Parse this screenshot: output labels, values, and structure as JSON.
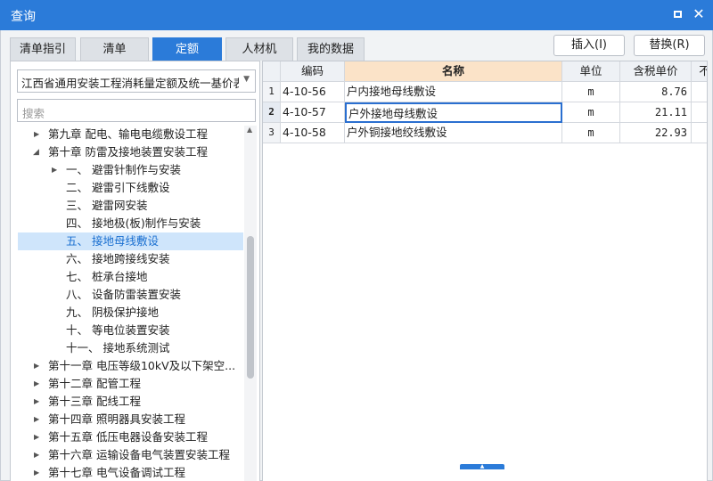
{
  "window": {
    "title": "查询",
    "maximize_icon": "maximize-icon",
    "close_glyph": "✕"
  },
  "tabs": [
    {
      "label": "清单指引",
      "active": false
    },
    {
      "label": "清单",
      "active": false
    },
    {
      "label": "定额",
      "active": true
    },
    {
      "label": "人材机",
      "active": false
    },
    {
      "label": "我的数据",
      "active": false
    }
  ],
  "actions": {
    "insert_label": "插入(I)",
    "replace_label": "替换(R)"
  },
  "library_select": {
    "value": "江西省通用安装工程消耗量定额及统一基价表("
  },
  "search": {
    "placeholder": "搜索"
  },
  "tree": [
    {
      "label": "第九章 配电、输电电缆敷设工程",
      "level": 1,
      "expander": "collapsed"
    },
    {
      "label": "第十章 防雷及接地装置安装工程",
      "level": 1,
      "expander": "expanded"
    },
    {
      "label": "一、 避雷针制作与安装",
      "level": 2,
      "expander": "collapsed"
    },
    {
      "label": "二、 避雷引下线敷设",
      "level": 2,
      "expander": "none"
    },
    {
      "label": "三、 避雷网安装",
      "level": 2,
      "expander": "none"
    },
    {
      "label": "四、 接地极(板)制作与安装",
      "level": 2,
      "expander": "none"
    },
    {
      "label": "五、 接地母线敷设",
      "level": 2,
      "expander": "none",
      "selected": true
    },
    {
      "label": "六、 接地跨接线安装",
      "level": 2,
      "expander": "none"
    },
    {
      "label": "七、 桩承台接地",
      "level": 2,
      "expander": "none"
    },
    {
      "label": "八、 设备防雷装置安装",
      "level": 2,
      "expander": "none"
    },
    {
      "label": "九、 阴极保护接地",
      "level": 2,
      "expander": "none"
    },
    {
      "label": "十、 等电位装置安装",
      "level": 2,
      "expander": "none"
    },
    {
      "label": "十一、 接地系统测试",
      "level": 2,
      "expander": "none"
    },
    {
      "label": "第十一章 电压等级10kV及以下架空...",
      "level": 1,
      "expander": "collapsed"
    },
    {
      "label": "第十二章 配管工程",
      "level": 1,
      "expander": "collapsed"
    },
    {
      "label": "第十三章 配线工程",
      "level": 1,
      "expander": "collapsed"
    },
    {
      "label": "第十四章 照明器具安装工程",
      "level": 1,
      "expander": "collapsed"
    },
    {
      "label": "第十五章 低压电器设备安装工程",
      "level": 1,
      "expander": "collapsed"
    },
    {
      "label": "第十六章 运输设备电气装置安装工程",
      "level": 1,
      "expander": "collapsed"
    },
    {
      "label": "第十七章 电气设备调试工程",
      "level": 1,
      "expander": "collapsed"
    }
  ],
  "table": {
    "columns": [
      "编码",
      "名称",
      "单位",
      "含税单价",
      "不"
    ],
    "rows": [
      {
        "num": "1",
        "code": "4-10-56",
        "name": "户内接地母线敷设",
        "unit": "m",
        "price": "8.76"
      },
      {
        "num": "2",
        "code": "4-10-57",
        "name": "户外接地母线敷设",
        "unit": "m",
        "price": "21.11",
        "current": true
      },
      {
        "num": "3",
        "code": "4-10-58",
        "name": "户外铜接地绞线敷设",
        "unit": "m",
        "price": "22.93"
      }
    ]
  },
  "colors": {
    "accent": "#2b7bd9",
    "selected_row": "#cfe5fb",
    "name_header": "#fbe3c8"
  }
}
